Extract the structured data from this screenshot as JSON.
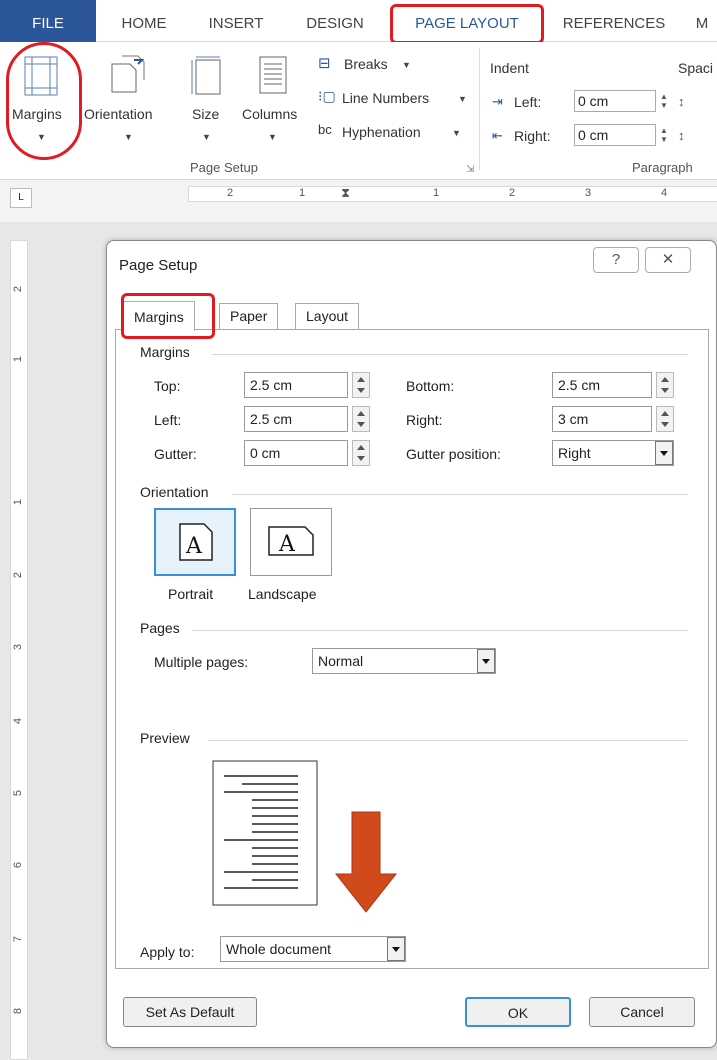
{
  "ribbon_tabs": {
    "file": "FILE",
    "home": "HOME",
    "insert": "INSERT",
    "design": "DESIGN",
    "page_layout": "PAGE LAYOUT",
    "references": "REFERENCES",
    "more": "M"
  },
  "ribbon": {
    "margins": "Margins",
    "orientation": "Orientation",
    "size": "Size",
    "columns": "Columns",
    "breaks": "Breaks",
    "line_numbers": "Line Numbers",
    "hyphenation": "Hyphenation",
    "page_setup_group": "Page Setup",
    "indent": "Indent",
    "indent_left_label": "Left:",
    "indent_left_value": "0 cm",
    "indent_right_label": "Right:",
    "indent_right_value": "0 cm",
    "spacing": "Spaci",
    "paragraph_group": "Paragraph"
  },
  "ruler": {
    "h_numbers": [
      "2",
      "1",
      "1",
      "2",
      "3",
      "4"
    ],
    "v_numbers": [
      "2",
      "1",
      "1",
      "2",
      "3",
      "4",
      "5",
      "6",
      "7",
      "8"
    ]
  },
  "dialog": {
    "title": "Page Setup",
    "help": "?",
    "close": "✕",
    "tabs": {
      "margins": "Margins",
      "paper": "Paper",
      "layout": "Layout"
    },
    "margins_section": "Margins",
    "top_label": "Top:",
    "top_value": "2.5 cm",
    "bottom_label": "Bottom:",
    "bottom_value": "2.5 cm",
    "left_label": "Left:",
    "left_value": "2.5 cm",
    "right_label": "Right:",
    "right_value": "3 cm",
    "gutter_label": "Gutter:",
    "gutter_value": "0 cm",
    "gutter_position_label": "Gutter position:",
    "gutter_position_value": "Right",
    "orientation_section": "Orientation",
    "portrait": "Portrait",
    "landscape": "Landscape",
    "pages_section": "Pages",
    "multiple_pages_label": "Multiple pages:",
    "multiple_pages_value": "Normal",
    "preview_section": "Preview",
    "apply_to_label": "Apply to:",
    "apply_to_value": "Whole document",
    "set_as_default": "Set As Default",
    "ok": "OK",
    "cancel": "Cancel"
  },
  "colors": {
    "file_tab": "#2b579a",
    "highlight_ring": "#e11b22",
    "arrow": "#d04a1c"
  }
}
